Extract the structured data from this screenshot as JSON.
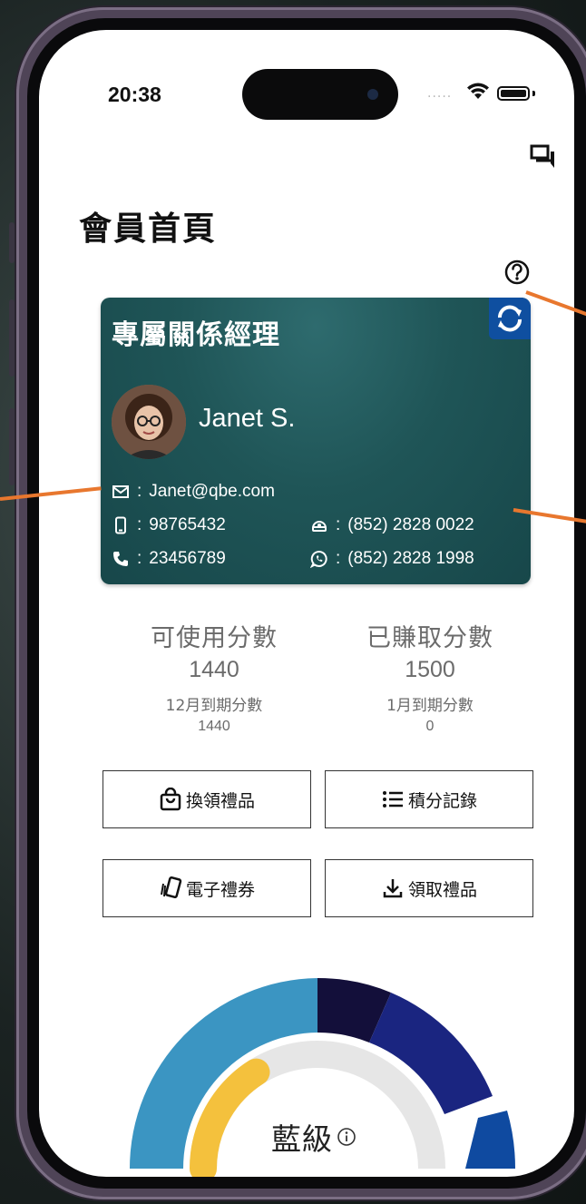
{
  "status_bar": {
    "time": "20:38",
    "signal": "....."
  },
  "page": {
    "title": "會員首頁"
  },
  "manager_card": {
    "title": "專屬關係經理",
    "name": "Janet S.",
    "email": "Janet@qbe.com",
    "mobile": "98765432",
    "phone": "23456789",
    "office": "(852) 2828 0022",
    "whatsapp": "(852) 2828 1998",
    "separator": ":"
  },
  "points": {
    "available": {
      "label": "可使用分數",
      "value": "1440",
      "expiry_label": "12月到期分數",
      "expiry_value": "1440"
    },
    "earned": {
      "label": "已賺取分數",
      "value": "1500",
      "expiry_label": "1月到期分數",
      "expiry_value": "0"
    }
  },
  "actions": {
    "redeem": "換領禮品",
    "history": "積分記錄",
    "evoucher": "電子禮券",
    "collect": "領取禮品"
  },
  "tier": {
    "label": "藍級",
    "progress": 0.32,
    "colors": {
      "light_blue": "#3b95c2",
      "dark_navy": "#130f3a",
      "navy": "#1a2580",
      "blue": "#0f4aa0",
      "progress": "#f4c13d",
      "track": "#e6e6e6"
    }
  },
  "accent_colors": {
    "card": "#1f5557",
    "pointer": "#e8772e",
    "refresh": "#0f4fa0"
  },
  "icons": [
    "chat-icon",
    "help-icon",
    "refresh-icon",
    "email-icon",
    "mobile-icon",
    "phone-icon",
    "office-phone-icon",
    "whatsapp-icon",
    "shopping-bag-icon",
    "list-icon",
    "voucher-icon",
    "download-icon",
    "info-icon"
  ]
}
